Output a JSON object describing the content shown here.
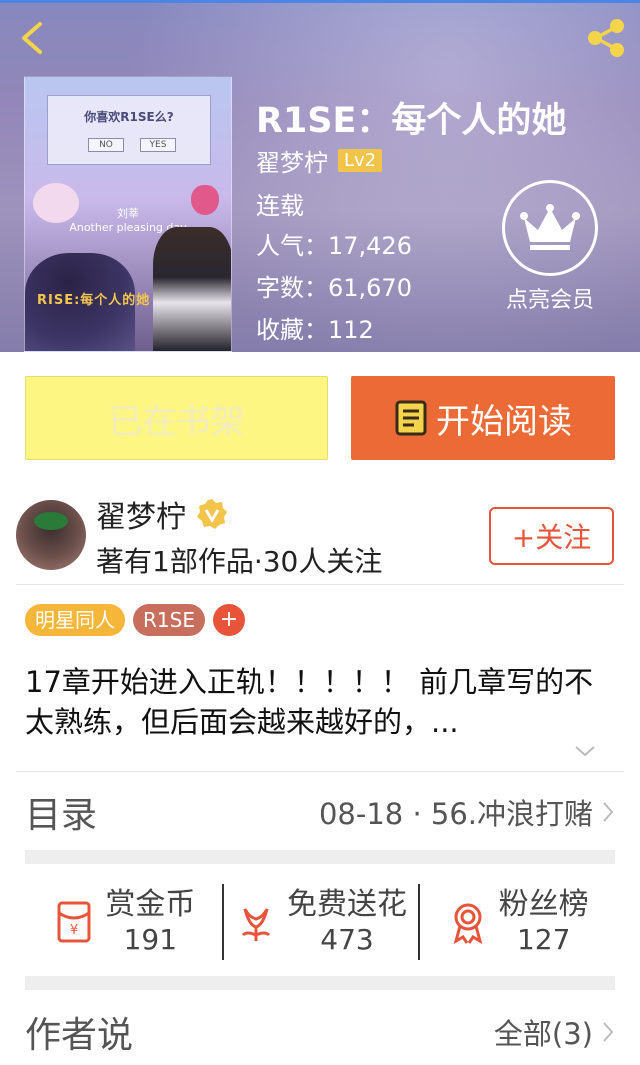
{
  "book": {
    "title": "R1SE：每个人的她",
    "author": "翟梦柠",
    "level": "Lv2",
    "status": "连载",
    "popularity": "人气：17,426",
    "word_count": "字数：61,670",
    "favorites": "收藏：112"
  },
  "cover": {
    "question": "你喜欢R1SE么?",
    "no_label": "NO",
    "yes_label": "YES",
    "line1": "刘莘",
    "line2": "Another pleasing day",
    "title_art": "RISE:每个人的她"
  },
  "vip": {
    "label": "点亮会员"
  },
  "actions": {
    "shelf_label": "已在书架",
    "read_label": "开始阅读"
  },
  "author_card": {
    "name": "翟梦柠",
    "meta": "著有1部作品·30人关注",
    "follow_label": "+关注"
  },
  "tags": [
    "明星同人",
    "R1SE",
    "+"
  ],
  "description": "17章开始进入正轨！！！！！ 前几章写的不太熟练，但后面会越来越好的，...",
  "toc": {
    "label": "目录",
    "latest": "08-18 · 56.冲浪打赌"
  },
  "perks": [
    {
      "label": "赏金币",
      "value": "191",
      "icon": "red-envelope-icon"
    },
    {
      "label": "免费送花",
      "value": "473",
      "icon": "flower-icon"
    },
    {
      "label": "粉丝榜",
      "value": "127",
      "icon": "medal-icon"
    }
  ],
  "author_notes": {
    "label": "作者说",
    "all_label": "全部(3)"
  },
  "colors": {
    "accent": "#ec6a35",
    "tag_star": "#f6b63a",
    "tag_rise": "#c76f5c",
    "follow": "#e8543a",
    "shelf": "#fdf683"
  }
}
